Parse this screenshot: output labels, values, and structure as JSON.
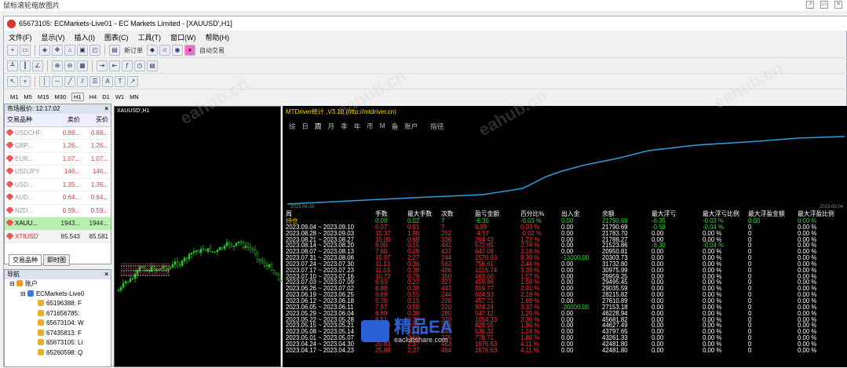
{
  "caption": {
    "title": "鼠标滚轮缩放图片",
    "controls": [
      "↗",
      "▭",
      "✕"
    ]
  },
  "window": {
    "title": "65673105: ECMarkets-Live01 - EC Markets Limited - [XAUUSD',H1]"
  },
  "menu": [
    "文件(F)",
    "显示(V)",
    "插入(I)",
    "图表(C)",
    "工具(T)",
    "窗口(W)",
    "帮助(H)"
  ],
  "toolbar": {
    "new_order": "新订单",
    "auto_trade": "自动交易"
  },
  "timeframes": [
    "M1",
    "M5",
    "M15",
    "M30",
    "H1",
    "H4",
    "D1",
    "W1",
    "MN"
  ],
  "market_watch": {
    "title": "市场报价: 12:17:02",
    "headers": [
      "交易品种",
      "卖价",
      "买价"
    ],
    "rows": [
      {
        "sym": "USDCHF",
        "bid": "0.88...",
        "ask": "0.88..."
      },
      {
        "sym": "GBP...",
        "bid": "1.26...",
        "ask": "1.26..."
      },
      {
        "sym": "EUR...",
        "bid": "1.07...",
        "ask": "1.07..."
      },
      {
        "sym": "USDJPY",
        "bid": "146...",
        "ask": "146..."
      },
      {
        "sym": "USD...",
        "bid": "1.35...",
        "ask": "1.36..."
      },
      {
        "sym": "AUD...",
        "bid": "0.64...",
        "ask": "0.64..."
      },
      {
        "sym": "NZD...",
        "bid": "0.59...",
        "ask": "0.59..."
      },
      {
        "sym": "XAUU...",
        "bid": "1943...",
        "ask": "1944..."
      },
      {
        "sym": "XTIUSD'",
        "bid": "85.543",
        "ask": "85.581"
      }
    ],
    "tabs": [
      "交易品种",
      "即时图"
    ]
  },
  "navigator": {
    "title": "导航",
    "root": "账户",
    "server": "ECMarkets-Live0",
    "accounts": [
      "65196388: F",
      "671656785: ",
      "65673104: W",
      "67435813: F",
      "65673105: Li",
      "65260598: Q"
    ]
  },
  "chart": {
    "title": "XAUUSD',H1"
  },
  "indicator": {
    "title": "MTDriver统计 ,V3.10 (http://mtdriver.cn)",
    "tabs": [
      "综",
      "日",
      "周",
      "月",
      "季",
      "年",
      "币",
      "M",
      "备",
      "账户",
      "",
      "指径"
    ],
    "start_date": "2023.04.30",
    "end_date": "2023.09.04",
    "headers": [
      "周",
      "手数",
      "最大手数",
      "次数",
      "盈亏金额",
      "百分比%",
      "出入金",
      "余额",
      "最大浮亏",
      "最大浮亏比例",
      "最大浮盈金额",
      "最大浮盈比例"
    ],
    "rows": [
      [
        "持仓",
        "0.09",
        "0.02",
        "7",
        "-6.35",
        "-0.03 %",
        "0.00",
        "21790.69",
        "-6.35",
        "-0.03 %",
        "0.00",
        "0.00 %"
      ],
      [
        "2023.09.04 ~ 2023.09.10",
        "0.07",
        "0.01",
        "7",
        "6.99",
        "0.03 %",
        "0.00",
        "21790.69",
        "-0.58",
        "-0.04 %",
        "0",
        "0.00 %"
      ],
      [
        "2023.08.28 ~ 2023.09.03",
        "15.37",
        "1.98",
        "252",
        "-4.57",
        "-0.02 %",
        "0.00",
        "21783.70",
        "0.00",
        "0.00 %",
        "0",
        "0.00 %"
      ],
      [
        "2023.08.21 ~ 2023.08.27",
        "10.00",
        "0.60",
        "336",
        "264.43",
        "1.23 %",
        "0.00",
        "21788.27",
        "0.00",
        "0.00 %",
        "0",
        "0.00 %"
      ],
      [
        "2023.08.14 ~ 2023.08.20",
        "8.00",
        "0.15",
        "441",
        "572.65",
        "2.74 %",
        "0.00",
        "21523.86",
        "-8.30",
        "-0.04 %",
        "0",
        "0.00 %"
      ],
      [
        "2023.08.07 ~ 2023.08.13",
        "7.60",
        "0.09",
        "437",
        "647.08",
        "3.19 %",
        "0.00",
        "20950.81",
        "0.00",
        "0.00 %",
        "0",
        "0.00 %"
      ],
      [
        "2023.07.31 ~ 2023.08.06",
        "19.97",
        "2.27",
        "244",
        "1570.93",
        "8.39 %",
        "-13000.00",
        "20303.73",
        "0.00",
        "0.00 %",
        "0",
        "0.00 %"
      ],
      [
        "2023.07.24 ~ 2023.07.30",
        "11.13",
        "0.36",
        "562",
        "756.61",
        "2.44 %",
        "0.00",
        "31732.80",
        "0.00",
        "0.00 %",
        "0",
        "0.00 %"
      ],
      [
        "2023.07.17 ~ 2023.07.23",
        "11.03",
        "0.38",
        "486",
        "1016.74",
        "3.39 %",
        "0.00",
        "30975.99",
        "0.00",
        "0.00 %",
        "0",
        "0.00 %"
      ],
      [
        "2023.07.10 ~ 2023.07.16",
        "10.72",
        "0.79",
        "350",
        "463.00",
        "1.57 %",
        "0.00",
        "29959.25",
        "0.00",
        "0.00 %",
        "0",
        "0.00 %"
      ],
      [
        "2023.07.03 ~ 2023.07.09",
        "6.63",
        "0.22",
        "327",
        "459.86",
        "1.58 %",
        "0.00",
        "29495.45",
        "0.00",
        "0.00 %",
        "0",
        "0.00 %"
      ],
      [
        "2023.06.26 ~ 2023.07.02",
        "8.88",
        "0.38",
        "443",
        "819.77",
        "2.91 %",
        "0.00",
        "29035.59",
        "0.00",
        "0.00 %",
        "0",
        "0.00 %"
      ],
      [
        "2023.06.19 ~ 2023.06.25",
        "6.69",
        "0.55",
        "244",
        "604.93",
        "2.19 %",
        "0.00",
        "28215.82",
        "0.00",
        "0.00 %",
        "0",
        "0.00 %"
      ],
      [
        "2023.06.12 ~ 2023.06.18",
        "5.78",
        "0.15",
        "228",
        "457.71",
        "1.69 %",
        "0.00",
        "27610.89",
        "0.00",
        "0.00 %",
        "0",
        "0.00 %"
      ],
      [
        "2023.06.05 ~ 2023.06.11",
        "7.97",
        "0.58",
        "220",
        "924.24",
        "3.32 %",
        "-20000.00",
        "27153.18",
        "0.00",
        "0.00 %",
        "0",
        "0.00 %"
      ],
      [
        "2023.05.29 ~ 2023.06.04",
        "8.89",
        "0.38",
        "285",
        "547.12",
        "1.20 %",
        "0.00",
        "46228.94",
        "0.00",
        "0.00 %",
        "0",
        "0.00 %"
      ],
      [
        "2023.05.22 ~ 2023.05.28",
        "9.51",
        "0.38",
        "320",
        "1054.33",
        "2.36 %",
        "0.00",
        "45681.82",
        "0.00",
        "0.00 %",
        "0",
        "0.00 %"
      ],
      [
        "2023.05.15 ~ 2023.05.21",
        "11.28",
        "0.59",
        "388",
        "829.55",
        "1.90 %",
        "0.00",
        "44627.49",
        "0.00",
        "0.00 %",
        "0",
        "0.00 %"
      ],
      [
        "2023.05.08 ~ 2023.05.14",
        "8.69",
        "0.11",
        "345",
        "536.32",
        "1.24 %",
        "0.00",
        "43797.65",
        "0.00",
        "0.00 %",
        "0",
        "0.00 %"
      ],
      [
        "2023.05.01 ~ 2023.05.07",
        "9.70",
        "0.60",
        "326",
        "778.71",
        "1.86 %",
        "0.00",
        "43261.33",
        "0.00",
        "0.00 %",
        "0",
        "0.00 %"
      ],
      [
        "2023.04.24 ~ 2023.04.30",
        "20.83",
        "2.37",
        "463",
        "1676.63",
        "4.11 %",
        "0.00",
        "42481.80",
        "0.00",
        "0.00 %",
        "0",
        "0.00 %"
      ],
      [
        "2023.04.17 ~ 2023.04.23",
        "25.88",
        "2.37",
        "464",
        "1676.63",
        "4.11 %",
        "0.00",
        "42481.80",
        "0.00",
        "0.00 %",
        "0",
        "0.00 %"
      ]
    ]
  },
  "watermarks": [
    "eahub.cn",
    "eahub.cn",
    "eahub.cn",
    "eahub.cn"
  ],
  "logo": {
    "text": "精品EA",
    "sub": "eaclubshare.com"
  }
}
